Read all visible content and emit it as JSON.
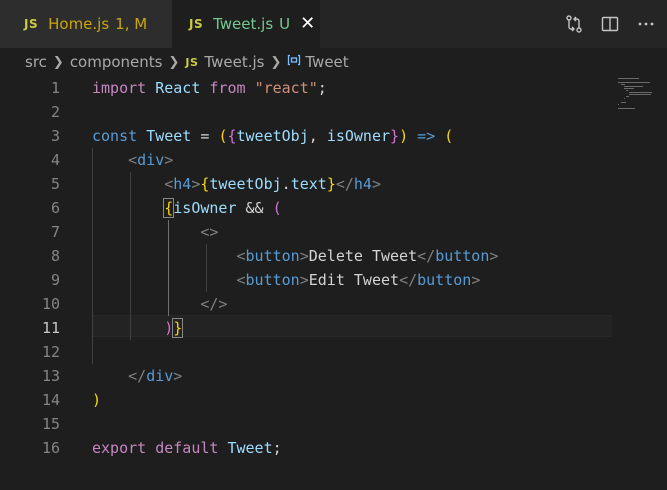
{
  "tabs": [
    {
      "badge": "JS",
      "name": "Home.js",
      "status": "1, M",
      "active": false
    },
    {
      "badge": "JS",
      "name": "Tweet.js",
      "status": "U",
      "active": true,
      "close": "✕"
    }
  ],
  "tab_actions": [
    {
      "icon": "git-compare-icon"
    },
    {
      "icon": "split-editor-icon"
    }
  ],
  "breadcrumb": {
    "folder1": "src",
    "folder2": "components",
    "file_badge": "JS",
    "file": "Tweet.js",
    "symbol": "Tweet"
  },
  "editor": {
    "current_line": 11,
    "line_numbers": [
      "1",
      "2",
      "3",
      "4",
      "5",
      "6",
      "7",
      "8",
      "9",
      "10",
      "11",
      "12",
      "13",
      "14",
      "15",
      "16"
    ],
    "lines": [
      [
        {
          "t": "import",
          "c": "kw"
        },
        {
          "t": " ",
          "c": "pu"
        },
        {
          "t": "React",
          "c": "vr"
        },
        {
          "t": " ",
          "c": "pu"
        },
        {
          "t": "from",
          "c": "kw"
        },
        {
          "t": " ",
          "c": "pu"
        },
        {
          "t": "\"react\"",
          "c": "st"
        },
        {
          "t": ";",
          "c": "pu"
        }
      ],
      [],
      [
        {
          "t": "const",
          "c": "dc"
        },
        {
          "t": " ",
          "c": "pu"
        },
        {
          "t": "Tweet",
          "c": "vr"
        },
        {
          "t": " = ",
          "c": "pu"
        },
        {
          "t": "(",
          "c": "b1"
        },
        {
          "t": "{",
          "c": "b2"
        },
        {
          "t": "tweetObj",
          "c": "vr"
        },
        {
          "t": ", ",
          "c": "pu"
        },
        {
          "t": "isOwner",
          "c": "vr"
        },
        {
          "t": "}",
          "c": "b2"
        },
        {
          "t": ")",
          "c": "b1"
        },
        {
          "t": " ",
          "c": "pu"
        },
        {
          "t": "=>",
          "c": "dc"
        },
        {
          "t": " ",
          "c": "pu"
        },
        {
          "t": "(",
          "c": "b1"
        }
      ],
      [
        {
          "t": "    ",
          "c": "pu"
        },
        {
          "t": "<",
          "c": "gr"
        },
        {
          "t": "div",
          "c": "tg"
        },
        {
          "t": ">",
          "c": "gr"
        }
      ],
      [
        {
          "t": "        ",
          "c": "pu"
        },
        {
          "t": "<",
          "c": "gr"
        },
        {
          "t": "h4",
          "c": "tg"
        },
        {
          "t": ">",
          "c": "gr"
        },
        {
          "t": "{",
          "c": "b1"
        },
        {
          "t": "tweetObj",
          "c": "vr"
        },
        {
          "t": ".",
          "c": "pu"
        },
        {
          "t": "text",
          "c": "vr"
        },
        {
          "t": "}",
          "c": "b1"
        },
        {
          "t": "</",
          "c": "gr"
        },
        {
          "t": "h4",
          "c": "tg"
        },
        {
          "t": ">",
          "c": "gr"
        }
      ],
      [
        {
          "t": "        ",
          "c": "pu"
        },
        {
          "t": "{",
          "c": "b1",
          "m": true
        },
        {
          "t": "isOwner",
          "c": "vr"
        },
        {
          "t": " && ",
          "c": "pu"
        },
        {
          "t": "(",
          "c": "b2"
        }
      ],
      [
        {
          "t": "            ",
          "c": "pu"
        },
        {
          "t": "<>",
          "c": "gr"
        }
      ],
      [
        {
          "t": "                ",
          "c": "pu"
        },
        {
          "t": "<",
          "c": "gr"
        },
        {
          "t": "button",
          "c": "tg"
        },
        {
          "t": ">",
          "c": "gr"
        },
        {
          "t": "Delete Tweet",
          "c": "pu"
        },
        {
          "t": "</",
          "c": "gr"
        },
        {
          "t": "button",
          "c": "tg"
        },
        {
          "t": ">",
          "c": "gr"
        }
      ],
      [
        {
          "t": "                ",
          "c": "pu"
        },
        {
          "t": "<",
          "c": "gr"
        },
        {
          "t": "button",
          "c": "tg"
        },
        {
          "t": ">",
          "c": "gr"
        },
        {
          "t": "Edit Tweet",
          "c": "pu"
        },
        {
          "t": "</",
          "c": "gr"
        },
        {
          "t": "button",
          "c": "tg"
        },
        {
          "t": ">",
          "c": "gr"
        }
      ],
      [
        {
          "t": "            ",
          "c": "pu"
        },
        {
          "t": "</>",
          "c": "gr"
        }
      ],
      [
        {
          "t": "        ",
          "c": "pu"
        },
        {
          "t": ")",
          "c": "b2"
        },
        {
          "t": "}",
          "c": "b1",
          "m": true
        }
      ],
      [],
      [
        {
          "t": "    ",
          "c": "pu"
        },
        {
          "t": "</",
          "c": "gr"
        },
        {
          "t": "div",
          "c": "tg"
        },
        {
          "t": ">",
          "c": "gr"
        }
      ],
      [
        {
          "t": ")",
          "c": "b1"
        }
      ],
      [],
      [
        {
          "t": "export",
          "c": "kw"
        },
        {
          "t": " ",
          "c": "pu"
        },
        {
          "t": "default",
          "c": "kw"
        },
        {
          "t": " ",
          "c": "pu"
        },
        {
          "t": "Tweet",
          "c": "vr"
        },
        {
          "t": ";",
          "c": "pu"
        }
      ]
    ]
  },
  "colors": {
    "background": "#1e1e1e",
    "tab_inactive": "#2d2d2d",
    "modified": "#cca700",
    "untracked": "#73c991",
    "js_badge": "#cbcb41"
  }
}
